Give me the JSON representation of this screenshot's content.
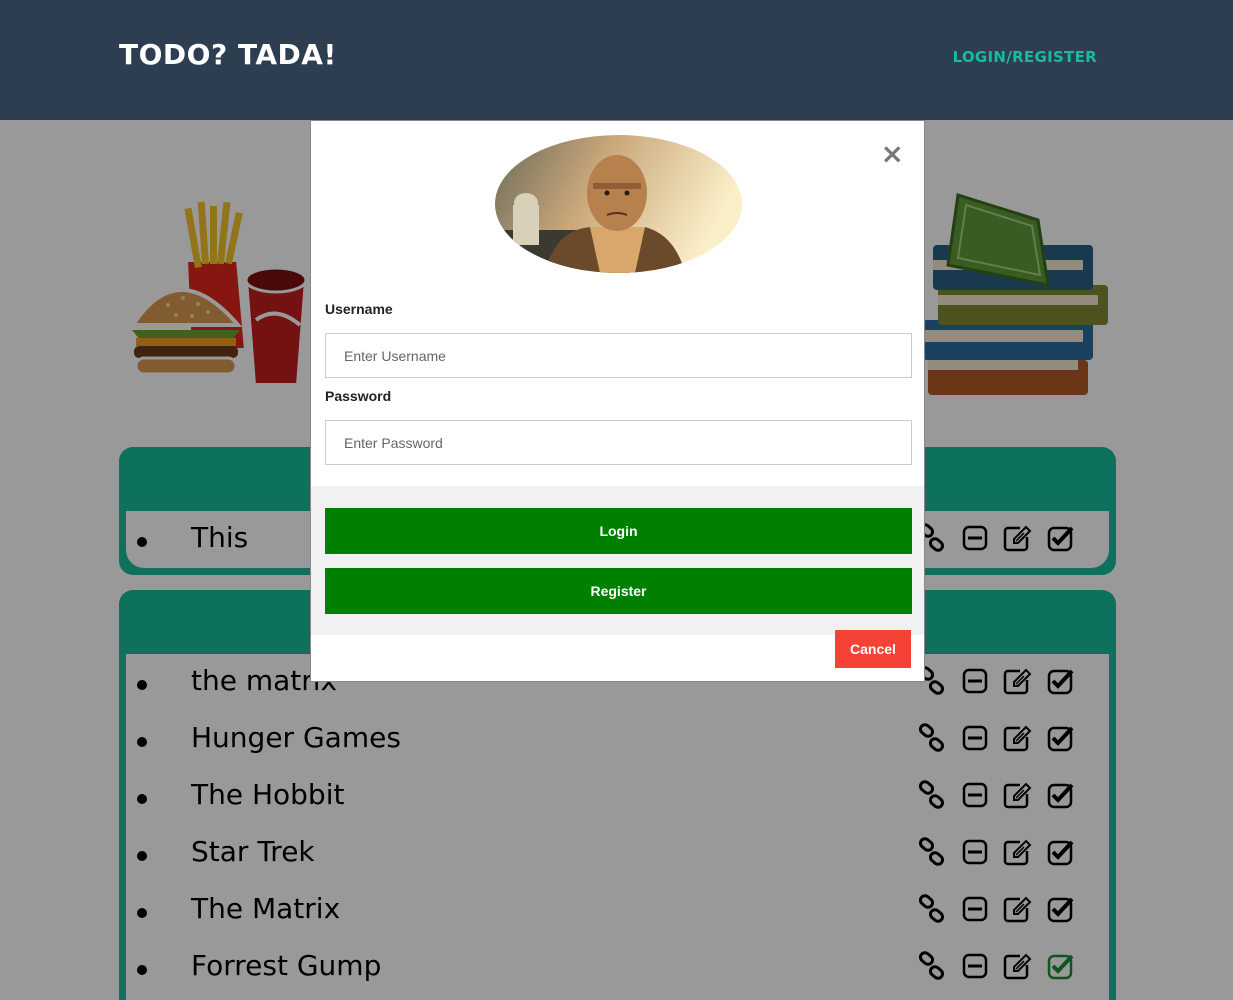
{
  "header": {
    "brand": "TODO? TADA!",
    "nav_link": "LOGIN/REGISTER"
  },
  "lists": [
    {
      "items": [
        {
          "text": "This",
          "done": false
        }
      ]
    },
    {
      "items": [
        {
          "text": "the matrix",
          "done": false
        },
        {
          "text": "Hunger Games",
          "done": false
        },
        {
          "text": "The Hobbit",
          "done": false
        },
        {
          "text": "Star Trek",
          "done": false
        },
        {
          "text": "The Matrix",
          "done": false
        },
        {
          "text": "Forrest Gump",
          "done": true
        }
      ]
    }
  ],
  "icons": {
    "item_actions": [
      "link-icon",
      "minus-square-icon",
      "edit-icon",
      "check-square-icon"
    ],
    "illustrations": [
      "fast-food-illustration",
      "books-illustration"
    ]
  },
  "modal": {
    "close_symbol": "×",
    "username_label": "Username",
    "username_placeholder": "Enter Username",
    "username_value": "",
    "password_label": "Password",
    "password_placeholder": "Enter Password",
    "password_value": "",
    "login_label": "Login",
    "register_label": "Register",
    "cancel_label": "Cancel"
  },
  "colors": {
    "header_bg": "#2c3e50",
    "accent": "#18bc9c",
    "button_green": "#008000",
    "cancel_red": "#f44336",
    "done_check": "#1a8c3a"
  }
}
